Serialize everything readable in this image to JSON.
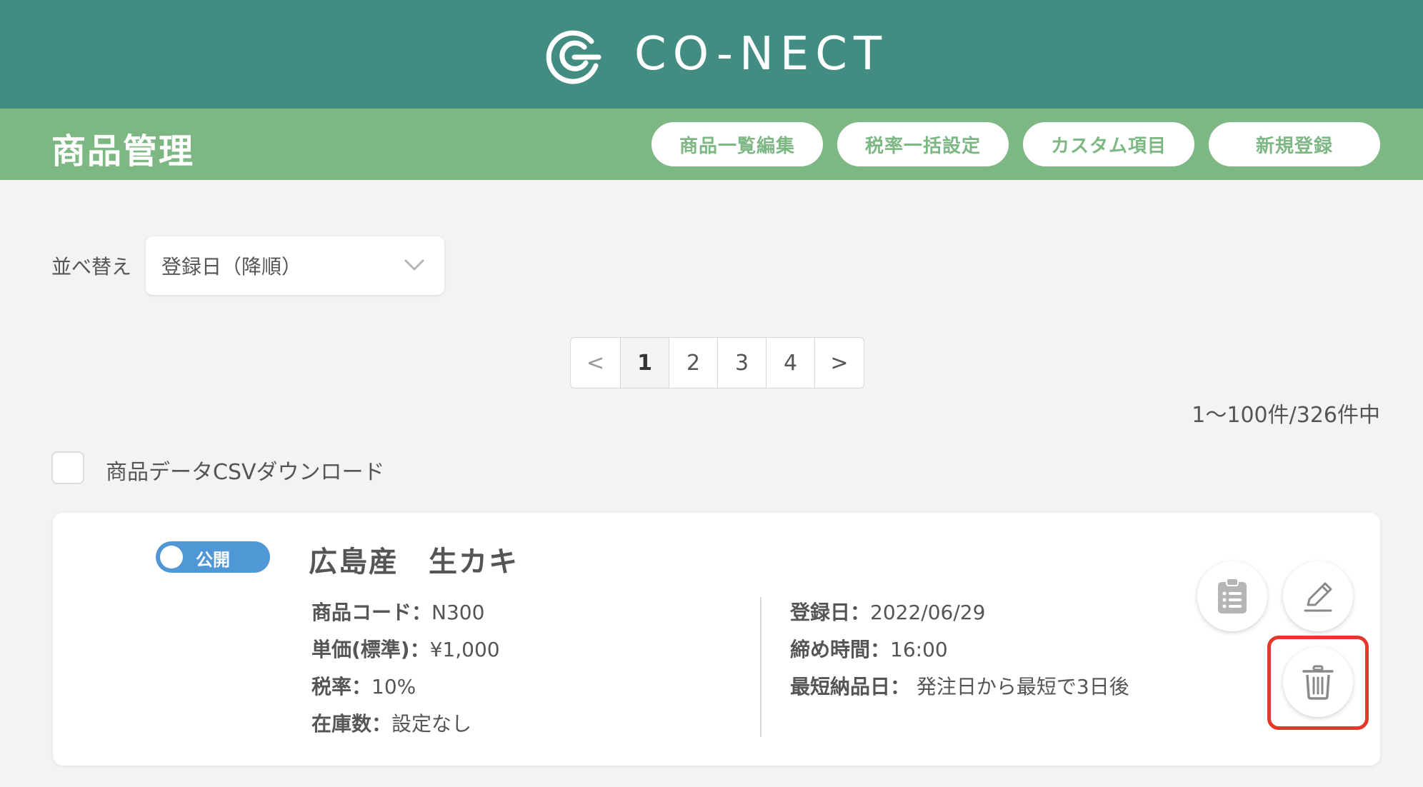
{
  "header": {
    "brand_name": "CO-NECT",
    "logo_icon": "co-nect-logo-icon",
    "background_color": "#428c82"
  },
  "subheader": {
    "title": "商品管理",
    "background_color": "#7db783",
    "actions": [
      {
        "label": "商品一覧編集"
      },
      {
        "label": "税率一括設定"
      },
      {
        "label": "カスタム項目"
      },
      {
        "label": "新規登録"
      }
    ]
  },
  "sort": {
    "label": "並べ替え",
    "selected": "登録日（降順）",
    "icon": "chevron-down-icon"
  },
  "pagination": {
    "prev": "<",
    "next": ">",
    "pages": [
      "1",
      "2",
      "3",
      "4"
    ],
    "current": "1"
  },
  "result_count": "1〜100件/326件中",
  "csv": {
    "label": "商品データCSVダウンロード",
    "checked": false
  },
  "product": {
    "status": "公開",
    "status_color": "#4f97d5",
    "name": "広島産　生カキ",
    "left_fields": [
      {
        "label": "商品コード：",
        "value": "N300"
      },
      {
        "label": "単価(標準)：",
        "value": "¥1,000"
      },
      {
        "label": "税率：",
        "value": "10%"
      },
      {
        "label": "在庫数：",
        "value": "設定なし"
      }
    ],
    "right_fields": [
      {
        "label": "登録日：",
        "value": "2022/06/29"
      },
      {
        "label": "締め時間：",
        "value": "16:00"
      },
      {
        "label": "最短納品日：",
        "value": " 発注日から最短で3日後"
      }
    ],
    "action_icons": [
      "clipboard-list-icon",
      "pencil-icon",
      "trash-icon"
    ],
    "highlight_color": "#e5372b"
  }
}
